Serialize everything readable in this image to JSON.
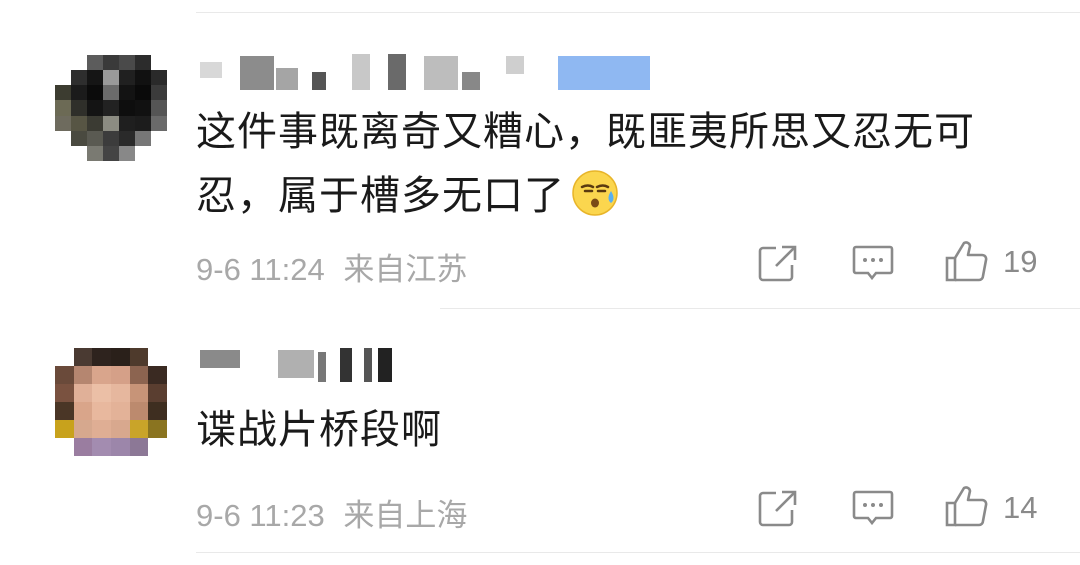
{
  "comments": [
    {
      "text": "这件事既离奇又糟心，既匪夷所思又忍无可忍，属于槽多无口了",
      "emoji": "cold-sweat-emoji",
      "timestamp": "9-6 11:24",
      "location": "来自江苏",
      "likes": "19"
    },
    {
      "text": "谍战片桥段啊",
      "timestamp": "9-6 11:23",
      "location": "来自上海",
      "likes": "14"
    }
  ],
  "icons": {
    "share": "share-icon",
    "reply": "comment-icon",
    "like": "thumbs-up-icon"
  }
}
